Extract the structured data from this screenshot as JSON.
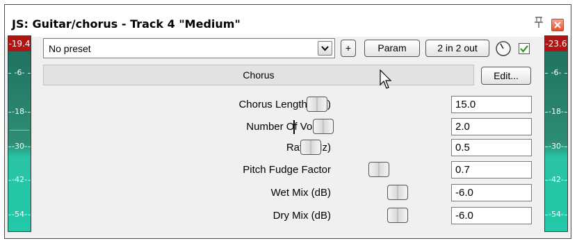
{
  "window": {
    "title": "JS: Guitar/chorus - Track 4 \"Medium\""
  },
  "meters": {
    "left_peak": "-19.4",
    "right_peak": "-23.6",
    "ticks": [
      "-6-",
      "-18-",
      "-30-",
      "-42-",
      "-54-"
    ]
  },
  "toolbar": {
    "preset_value": "No preset",
    "plus_label": "+",
    "param_label": "Param",
    "io_label": "2 in 2 out",
    "wet_checked": true
  },
  "effect": {
    "name": "Chorus",
    "edit_label": "Edit..."
  },
  "params": [
    {
      "label": "Chorus Length (ms)",
      "value": "15.0",
      "position": 0.05
    },
    {
      "label": "Number Of Voices",
      "value": "2.0",
      "position": 0.1
    },
    {
      "label": "Rate (Hz)",
      "value": "0.5",
      "position": 0.0
    },
    {
      "label": "Pitch Fudge Factor",
      "value": "0.7",
      "position": 0.55
    },
    {
      "label": "Wet Mix (dB)",
      "value": "-6.0",
      "position": 0.7
    },
    {
      "label": "Dry Mix (dB)",
      "value": "-6.0",
      "position": 0.7
    }
  ],
  "colors": {
    "meter_peak": "#b21414",
    "meter_fill": "#22c8a8",
    "check": "#2a9a2a"
  }
}
